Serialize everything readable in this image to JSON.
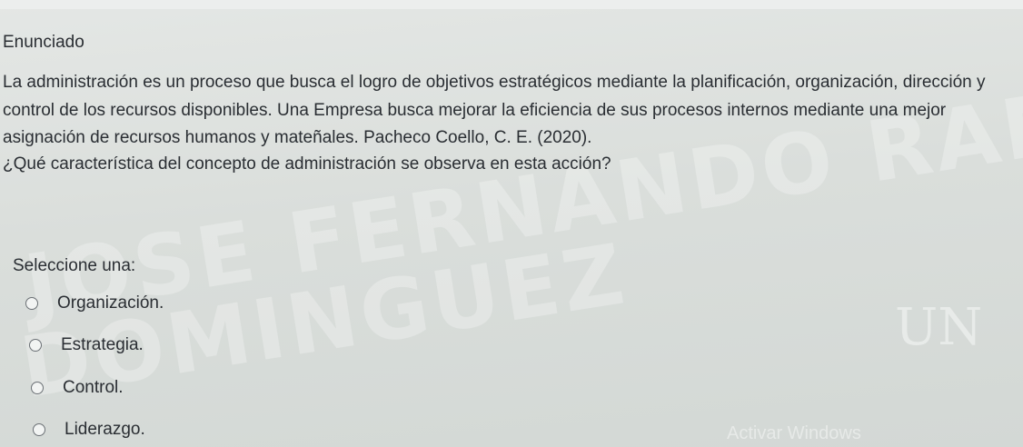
{
  "watermark": {
    "line1": "JOSE FERNANDO RAMIREZ",
    "line2": "DOMINGUEZ"
  },
  "logo_text": "UN",
  "os_overlay": "Activar Windows",
  "question": {
    "section_title": "Enunciado",
    "statement": "La administración es un proceso que busca el logro de objetivos estratégicos mediante la planificación, organización, dirección y control de los recursos disponibles. Una Empresa busca mejorar la eficiencia de sus procesos internos mediante una mejor asignación de recursos humanos y mateñales. Pacheco Coello, C. E. (2020).",
    "prompt": "¿Qué característica del concepto de administración se observa en esta acción?",
    "select_label": "Seleccione una:",
    "options": [
      {
        "label": "Organización."
      },
      {
        "label": "Estrategia."
      },
      {
        "label": "Control."
      },
      {
        "label": "Liderazgo."
      }
    ]
  }
}
